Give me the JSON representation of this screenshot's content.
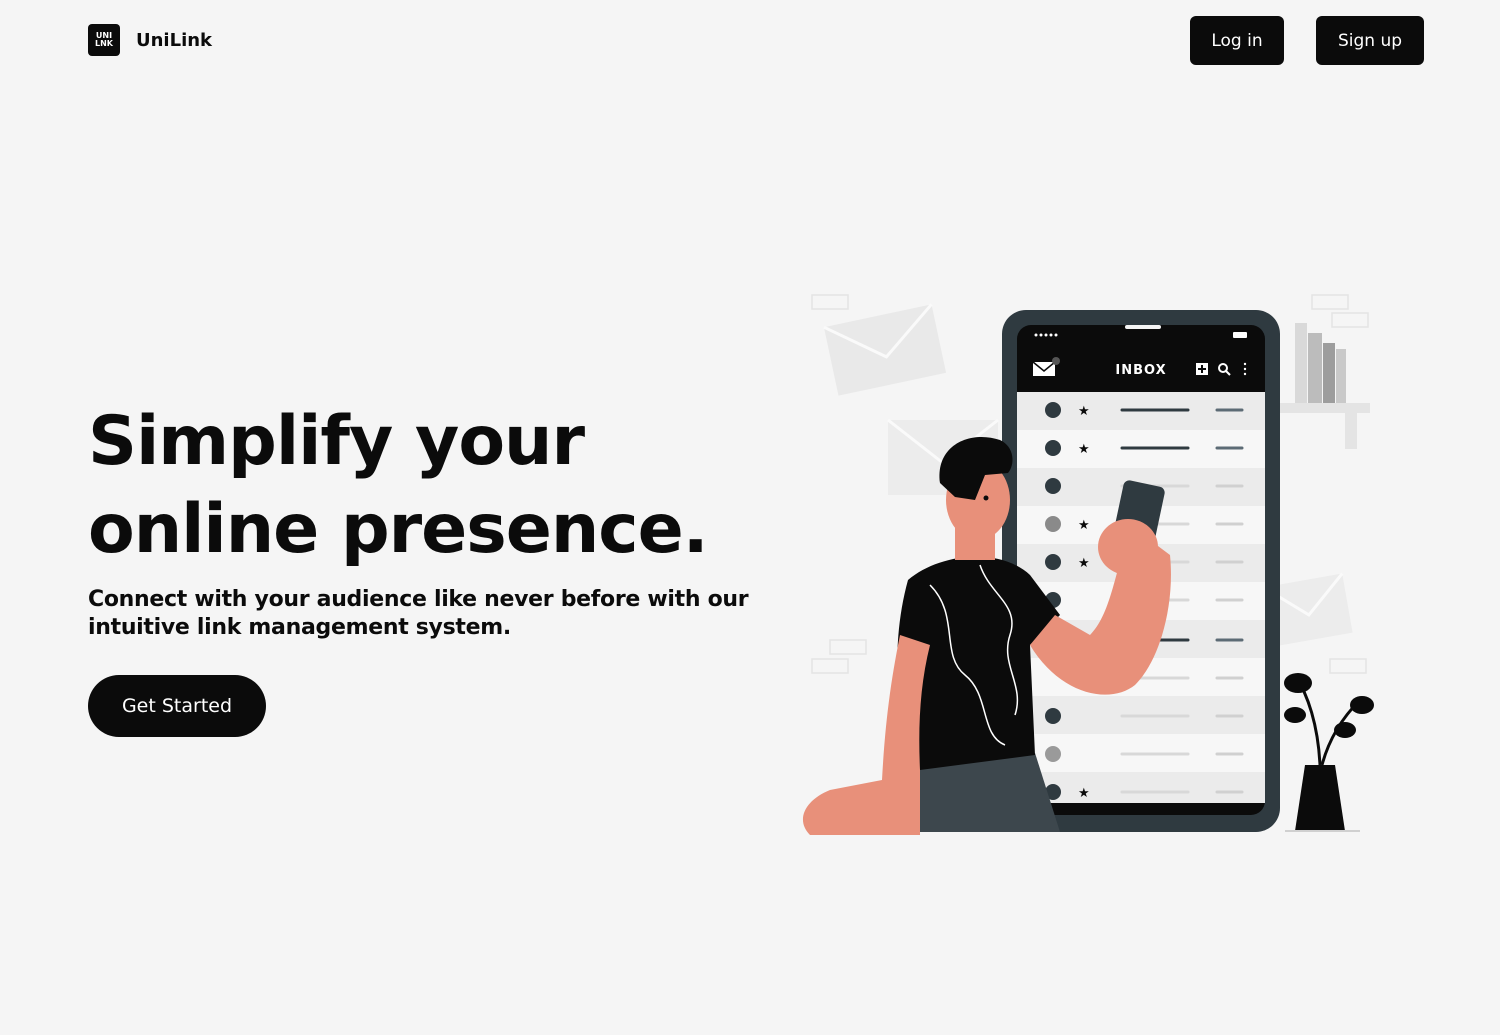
{
  "brand": {
    "logo_mark_line1": "UNI",
    "logo_mark_line2": "LNK",
    "name": "UniLink"
  },
  "nav": {
    "login_label": "Log in",
    "signup_label": "Sign up"
  },
  "hero": {
    "title_line1": "Simplify your",
    "title_line2": "online presence.",
    "subtitle": "Connect with your audience like never before with our intuitive link management system.",
    "cta_label": "Get Started"
  },
  "illustration": {
    "phone_header_title": "INBOX",
    "envelope_icon": "envelope-icon",
    "add_icon": "plus-square-icon",
    "search_icon": "search-icon",
    "more_icon": "vertical-dots-icon",
    "colors": {
      "skin": "#e8907a",
      "phone_frame": "#2f3a40",
      "shirt": "#0b0b0b",
      "pants": "#3d474d"
    }
  },
  "colors": {
    "background": "#f5f5f5",
    "primary": "#0b0b0b",
    "on_primary": "#ffffff"
  }
}
